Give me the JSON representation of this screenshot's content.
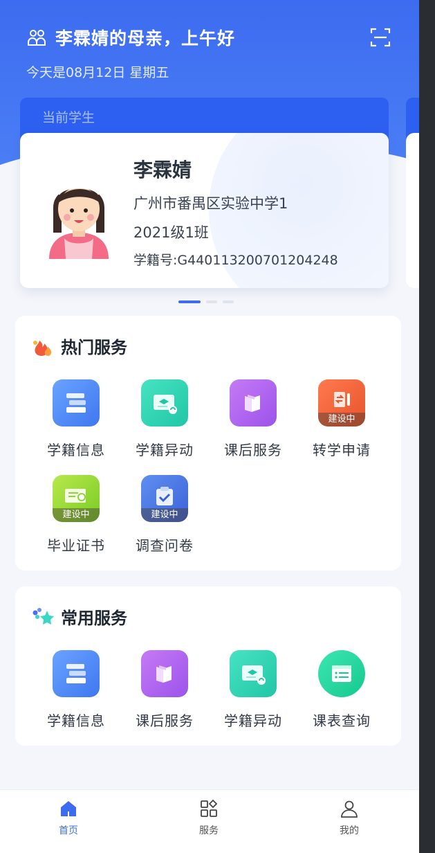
{
  "header": {
    "greeting": "李霖婧的母亲，上午好",
    "date": "今天是08月12日 星期五"
  },
  "student_card": {
    "tab_label": "当前学生",
    "name": "李霖婧",
    "school": "广州市番禺区实验中学1",
    "class": "2021级1班",
    "student_id": "学籍号:G440113200701204248"
  },
  "hot_services": {
    "title": "热门服务",
    "items": [
      {
        "label": "学籍信息",
        "icon": "student-records-icon",
        "color": "#4f86f5"
      },
      {
        "label": "学籍异动",
        "icon": "status-change-icon",
        "color": "#2fd2b2"
      },
      {
        "label": "课后服务",
        "icon": "books-icon",
        "color": "#b165ef"
      },
      {
        "label": "转学申请",
        "icon": "transfer-icon",
        "color": "#f1653a",
        "badge": "建设中"
      },
      {
        "label": "毕业证书",
        "icon": "certificate-icon",
        "color": "#98d935",
        "badge": "建设中"
      },
      {
        "label": "调查问卷",
        "icon": "clipboard-icon",
        "color": "#4b78e3",
        "badge": "建设中"
      }
    ]
  },
  "common_services": {
    "title": "常用服务",
    "items": [
      {
        "label": "学籍信息",
        "icon": "student-records-icon"
      },
      {
        "label": "课后服务",
        "icon": "books-icon"
      },
      {
        "label": "学籍异动",
        "icon": "status-change-icon"
      },
      {
        "label": "课表查询",
        "icon": "schedule-icon"
      }
    ]
  },
  "tabbar": {
    "items": [
      {
        "label": "首页",
        "icon": "home-icon",
        "active": true
      },
      {
        "label": "服务",
        "icon": "grid-icon",
        "active": false
      },
      {
        "label": "我的",
        "icon": "user-icon",
        "active": false
      }
    ]
  },
  "colors": {
    "primary": "#3d6cf0",
    "background": "#f4f6fb"
  }
}
